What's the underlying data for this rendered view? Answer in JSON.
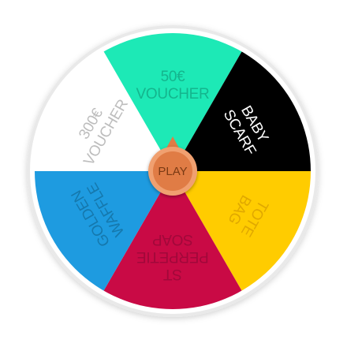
{
  "wheel": {
    "segments": [
      {
        "id": "voucher-50",
        "lines": [
          "50€",
          "VOUCHER"
        ],
        "fill": "#1de9b6",
        "text": "#14b58d"
      },
      {
        "id": "baby-scarf",
        "lines": [
          "BABY",
          "SCARF"
        ],
        "fill": "#000000",
        "text": "#ffffff"
      },
      {
        "id": "tote-bag",
        "lines": [
          "TOTE",
          "BAG"
        ],
        "fill": "#ffcc00",
        "text": "#e0a800"
      },
      {
        "id": "st-perpetie-soap",
        "lines": [
          "ST",
          "PERPETIE",
          "SOAP"
        ],
        "fill": "#c90a45",
        "text": "#a1083a"
      },
      {
        "id": "golden-waffle",
        "lines": [
          "GOLDEN",
          "WAFFLE"
        ],
        "fill": "#1e9be0",
        "text": "#1578ad"
      },
      {
        "id": "voucher-300",
        "lines": [
          "300€",
          "VOUCHER"
        ],
        "fill": "#ffffff",
        "text": "#bdbdbd"
      }
    ],
    "rim_color": "#e9e9e9",
    "play_button": {
      "label": "PLAY",
      "color": "#e07c45",
      "ring": "#f0a070",
      "text_color": "#7a3a14"
    }
  }
}
